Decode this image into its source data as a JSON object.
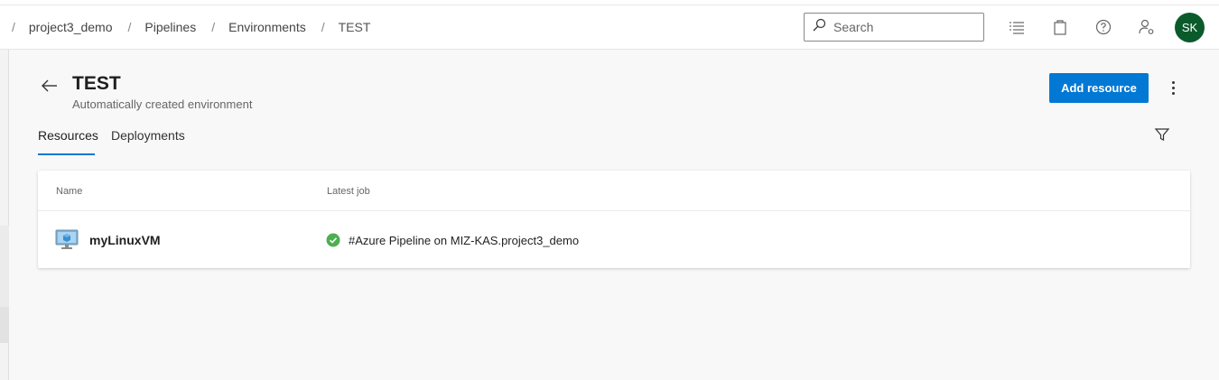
{
  "breadcrumb": {
    "separator": "/",
    "items": [
      "project3_demo",
      "Pipelines",
      "Environments",
      "TEST"
    ]
  },
  "search": {
    "placeholder": "Search"
  },
  "user": {
    "initials": "SK",
    "avatar_color": "#0b5a2b"
  },
  "environment": {
    "title": "TEST",
    "description": "Automatically created environment"
  },
  "actions": {
    "add_resource": "Add resource"
  },
  "tabs": [
    {
      "label": "Resources",
      "active": true
    },
    {
      "label": "Deployments",
      "active": false
    }
  ],
  "table": {
    "columns": [
      "Name",
      "Latest job"
    ],
    "rows": [
      {
        "name": "myLinuxVM",
        "latest_job": "#Azure Pipeline on MIZ-KAS.project3_demo",
        "status": "succeeded"
      }
    ]
  },
  "colors": {
    "accent": "#0078d4",
    "success": "#4caf50"
  }
}
